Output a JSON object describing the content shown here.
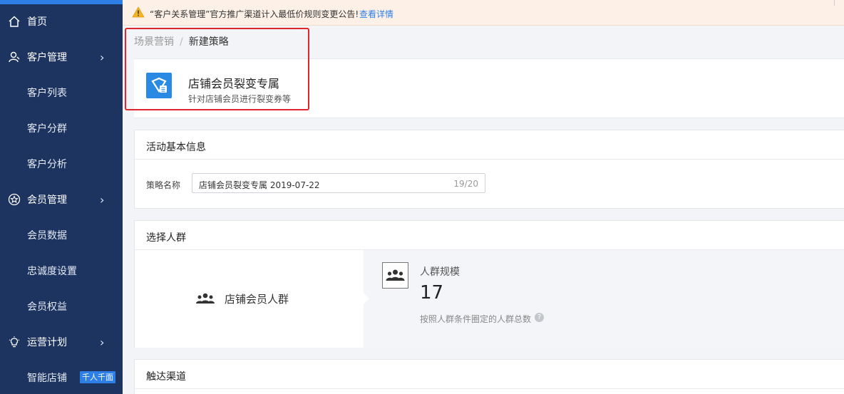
{
  "sidebar": {
    "items": [
      {
        "label": "首页",
        "icon": "home-icon"
      },
      {
        "label": "客户管理",
        "icon": "customer-icon",
        "chevron": "›"
      },
      {
        "label": "客户列表"
      },
      {
        "label": "客户分群"
      },
      {
        "label": "客户分析"
      },
      {
        "label": "会员管理",
        "icon": "star-icon",
        "chevron": "›"
      },
      {
        "label": "会员数据"
      },
      {
        "label": "忠诚度设置"
      },
      {
        "label": "会员权益"
      },
      {
        "label": "运营计划",
        "icon": "lightbulb-icon",
        "chevron": "›"
      },
      {
        "label": "智能店铺",
        "badge": "千人千面"
      }
    ]
  },
  "notice": {
    "text": "“客户关系管理”官方推广渠道计入最低价规则变更公告!",
    "link": "查看详情"
  },
  "breadcrumb": {
    "parent": "场景营销",
    "separator": "/",
    "current": "新建策略"
  },
  "strategy": {
    "title": "店铺会员裂变专属",
    "desc": "针对店铺会员进行裂变券等"
  },
  "basic_info": {
    "title": "活动基本信息",
    "name_label": "策略名称",
    "name_value": "店铺会员裂变专属 2019-07-22",
    "name_count": "19/20"
  },
  "crowd": {
    "title": "选择人群",
    "name": "店铺会员人群",
    "scale_title": "人群规模",
    "scale_value": "17",
    "scale_desc": "按照人群条件圈定的人群总数",
    "help": "?"
  },
  "channel": {
    "title": "触达渠道"
  },
  "colors": {
    "sidebar": "#1d3461",
    "accent": "#2d7fe6",
    "highlight": "#e0262b"
  }
}
